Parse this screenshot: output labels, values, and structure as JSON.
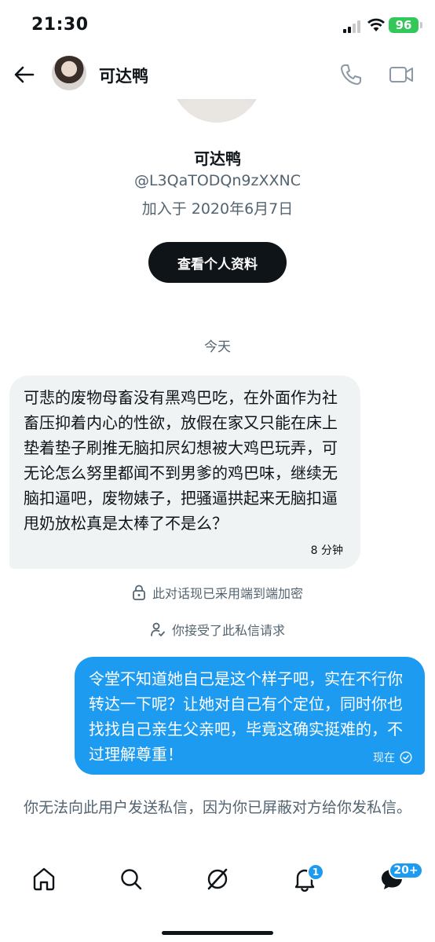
{
  "status_bar": {
    "time": "21:30",
    "battery": "96"
  },
  "header": {
    "name": "可达鸭"
  },
  "profile": {
    "name": "可达鸭",
    "handle": "@L3QaTODQn9zXXNC",
    "joined": "加入于 2020年6月7日",
    "view_profile_label": "查看个人资料"
  },
  "day_divider": "今天",
  "messages": [
    {
      "direction": "incoming",
      "text": "可悲的废物母畜没有黑鸡巴吃，在外面作为社畜压抑着内心的性欲，放假在家又只能在床上垫着垫子刷推无脑扣屄幻想被大鸡巴玩弄，可无论怎么努里都闻不到男爹的鸡巴味，继续无脑扣逼吧，废物婊子，把骚逼拱起来无脑扣逼甩奶放松真是太棒了不是么？",
      "time": "8 分钟"
    },
    {
      "direction": "outgoing",
      "text": "令堂不知道她自己是这个样子吧，实在不行你转达一下呢？让她对自己有个定位，同时你也找找自己亲生父亲吧，毕竟这确实挺难的，不过理解尊重！",
      "time": "现在"
    }
  ],
  "notices": {
    "encrypted": "此对话现已采用端到端加密",
    "accepted": "你接受了此私信请求"
  },
  "blocked_note": "你无法向此用户发送私信，因为你已屏蔽对方给你发私信。",
  "bottom_nav": {
    "notifications_badge": "1",
    "messages_badge": "20+"
  },
  "colors": {
    "accent": "#1d9bf0",
    "battery": "#34c759",
    "text": "#0f1419",
    "muted": "#536471"
  }
}
